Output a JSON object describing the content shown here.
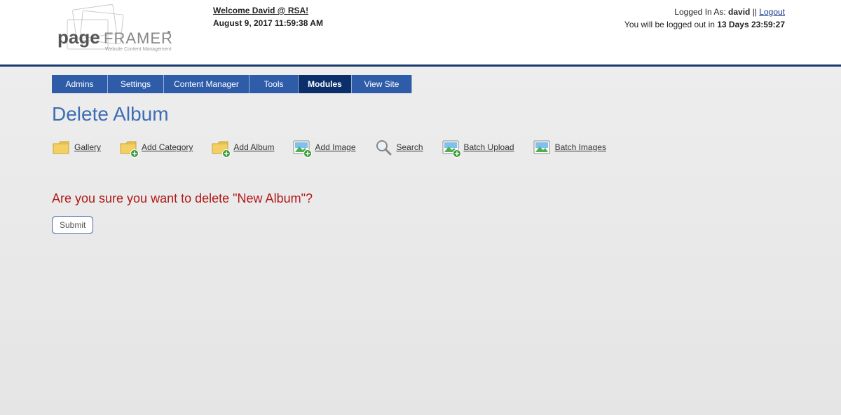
{
  "header": {
    "welcome_line": "Welcome David @ RSA!",
    "datetime": "August 9, 2017 11:59:38 AM",
    "logged_in_prefix": "Logged In As: ",
    "username": "david",
    "separator": " || ",
    "logout": "Logout",
    "timeout_prefix": "You will be logged out in ",
    "timeout_value": "13 Days 23:59:27"
  },
  "logo": {
    "brand_main": "page",
    "brand_sub": "FRAMER",
    "tagline": "Website Content Management"
  },
  "nav": [
    {
      "label": "Admins",
      "active": false,
      "wclass": "nav-widths-Admins"
    },
    {
      "label": "Settings",
      "active": false,
      "wclass": "nav-widths-Settings"
    },
    {
      "label": "Content Manager",
      "active": false,
      "wclass": "nav-widths-ContentManager"
    },
    {
      "label": "Tools",
      "active": false,
      "wclass": "nav-widths-Tools"
    },
    {
      "label": "Modules",
      "active": true,
      "wclass": "nav-widths-Modules"
    },
    {
      "label": "View Site",
      "active": false,
      "wclass": "nav-widths-ViewSite"
    }
  ],
  "page": {
    "title": "Delete Album",
    "confirm_text": "Are you sure you want to delete \"New Album\"?",
    "submit_label": "Submit"
  },
  "tools": {
    "gallery": "Gallery",
    "add_category": "Add Category",
    "add_album": "Add Album",
    "add_image": "Add Image",
    "search": "Search",
    "batch_upload": "Batch Upload",
    "batch_images": "Batch Images"
  }
}
